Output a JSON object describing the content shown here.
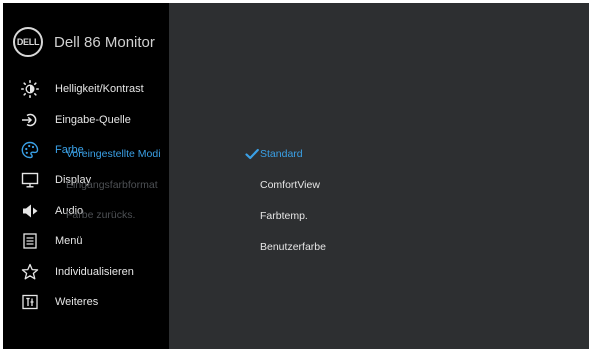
{
  "osd": {
    "brand_logo_text": "DELL",
    "title": "Dell 86 Monitor"
  },
  "nav": {
    "items": [
      {
        "label": "Helligkeit/Kontrast",
        "icon": "brightness-icon"
      },
      {
        "label": "Eingabe-Quelle",
        "icon": "input-source-icon"
      },
      {
        "label": "Farbe",
        "icon": "palette-icon",
        "active": true
      },
      {
        "label": "Display",
        "icon": "display-icon"
      },
      {
        "label": "Audio",
        "icon": "speaker-icon"
      },
      {
        "label": "Menü",
        "icon": "menu-icon"
      },
      {
        "label": "Individualisieren",
        "icon": "star-icon"
      },
      {
        "label": "Weiteres",
        "icon": "other-icon"
      }
    ]
  },
  "submenu": {
    "items": [
      {
        "label": "Voreingestellte Modi",
        "active": true
      },
      {
        "label": "Eingangsfarbformat",
        "active": false
      },
      {
        "label": "Farbe zurücks.",
        "active": false
      }
    ]
  },
  "options": {
    "items": [
      {
        "label": "Standard",
        "selected": true
      },
      {
        "label": "ComfortView",
        "selected": false
      },
      {
        "label": "Farbtemp.",
        "selected": false
      },
      {
        "label": "Benutzerfarbe",
        "selected": false
      }
    ]
  },
  "colors": {
    "accent": "#3aa0e6",
    "sidebar_bg": "#000000",
    "panel_bg": "#2d2f31",
    "text": "#e6e6e6",
    "disabled_text": "#4d5054"
  }
}
